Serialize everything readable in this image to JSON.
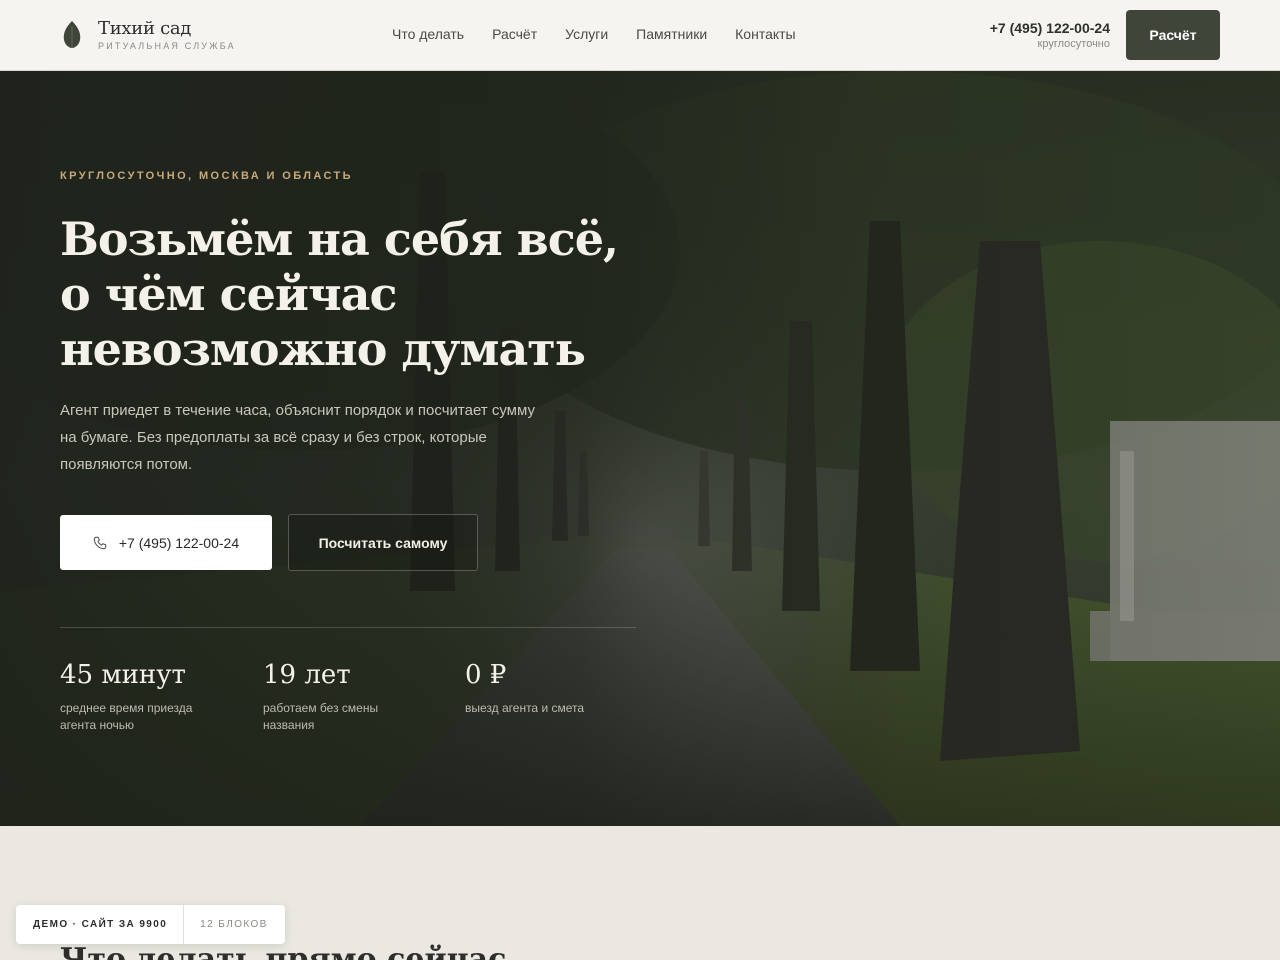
{
  "header": {
    "logo_name": "Тихий сад",
    "logo_sub": "РИТУАЛЬНАЯ СЛУЖБА",
    "nav": [
      "Что делать",
      "Расчёт",
      "Услуги",
      "Памятники",
      "Контакты"
    ],
    "phone": "+7 (495) 122-00-24",
    "phone_note": "круглосуточно",
    "cta": "Расчёт"
  },
  "hero": {
    "eyebrow": "КРУГЛОСУТОЧНО, МОСКВА И ОБЛАСТЬ",
    "title_lines": [
      "Возьмём на себя всё,",
      "о чём сейчас",
      "невозможно думать"
    ],
    "lead_lines": [
      "Агент приедет в течение часа, объяснит порядок и посчитает сумму",
      "на бумаге. Без предоплаты за всё сразу и без строк, которые",
      "появляются потом."
    ],
    "btn_phone": "+7 (495) 122-00-24",
    "btn_calc": "Посчитать самому",
    "stats": [
      {
        "value": "45 минут",
        "label_lines": [
          "среднее время приезда",
          "агента ночью"
        ]
      },
      {
        "value": "19 лет",
        "label_lines": [
          "работаем без смены",
          "названия"
        ]
      },
      {
        "value": "0 ₽",
        "label_lines": [
          "выезд агента и смета"
        ]
      }
    ]
  },
  "section": {
    "title": "Что делать прямо сейчас"
  },
  "demo": {
    "left": "ДЕМО · САЙТ ЗА 9900",
    "right": "12 БЛОКОВ"
  },
  "colors": {
    "accent_dark": "#3f4639",
    "eyebrow": "#c8a979",
    "page_bg": "#ebe8e2",
    "header_bg": "#f5f4f0"
  },
  "icons": {
    "logo": "leaf-icon",
    "phone": "phone-icon"
  }
}
